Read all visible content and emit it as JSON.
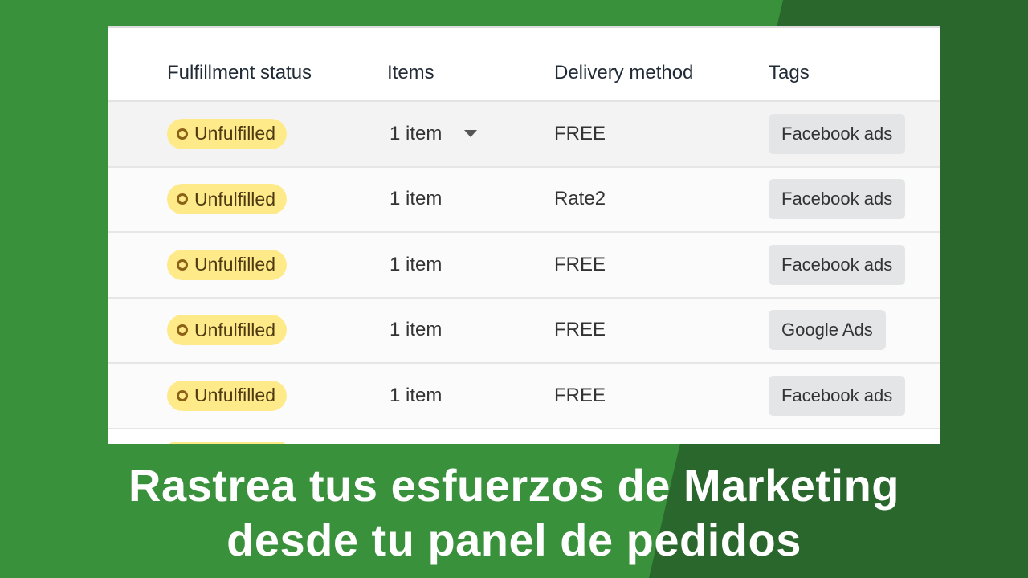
{
  "table": {
    "headers": [
      "Fulfillment status",
      "Items",
      "Delivery method",
      "Tags"
    ],
    "rows": [
      {
        "status": "Unfulfilled",
        "items": "1 item",
        "delivery": "FREE",
        "tag": "Facebook ads"
      },
      {
        "status": "Unfulfilled",
        "items": "1 item",
        "delivery": "Rate2",
        "tag": "Facebook ads"
      },
      {
        "status": "Unfulfilled",
        "items": "1 item",
        "delivery": "FREE",
        "tag": "Facebook ads"
      },
      {
        "status": "Unfulfilled",
        "items": "1 item",
        "delivery": "FREE",
        "tag": "Google Ads"
      },
      {
        "status": "Unfulfilled",
        "items": "1 item",
        "delivery": "FREE",
        "tag": "Facebook ads"
      }
    ]
  },
  "caption": {
    "line1": "Rastrea tus esfuerzos de Marketing",
    "line2": "desde tu panel de pedidos"
  },
  "colors": {
    "bg_light": "#3a913c",
    "bg_dark": "#29672c",
    "badge": "#ffea8a"
  }
}
